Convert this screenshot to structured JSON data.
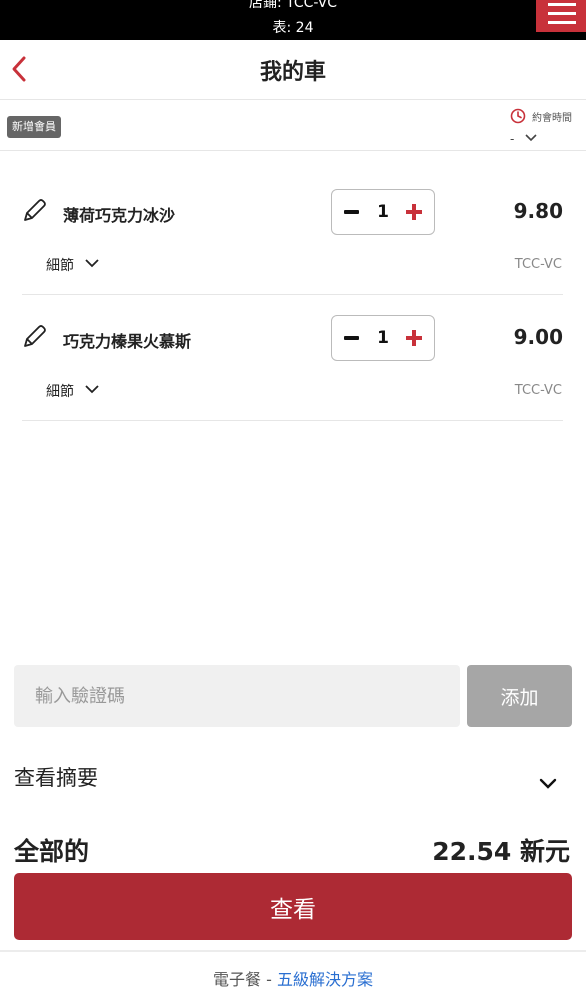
{
  "topbar": {
    "store": "店鋪: TCC-VC",
    "table": "表: 24"
  },
  "header": {
    "title": "我的車"
  },
  "member": {
    "badge": "新增會員",
    "appointment_label": "約會時間",
    "appointment_value": "-"
  },
  "cart": {
    "items": [
      {
        "name": "薄荷巧克力冰沙",
        "quantity": "1",
        "price": "9.80",
        "details_label": "細節",
        "store": "TCC-VC"
      },
      {
        "name": "巧克力榛果火慕斯",
        "quantity": "1",
        "price": "9.00",
        "details_label": "細節",
        "store": "TCC-VC"
      }
    ]
  },
  "voucher": {
    "placeholder": "輸入驗證碼",
    "add_label": "添加"
  },
  "summary": {
    "label": "查看摘要"
  },
  "total": {
    "label": "全部的",
    "value": "22.54 新元"
  },
  "checkout": {
    "label": "查看"
  },
  "footer": {
    "prefix": "電子餐 - ",
    "link": "五級解決方案"
  },
  "colors": {
    "accent": "#ad2a34",
    "menu": "#c8313a",
    "link": "#2a6fd1"
  }
}
